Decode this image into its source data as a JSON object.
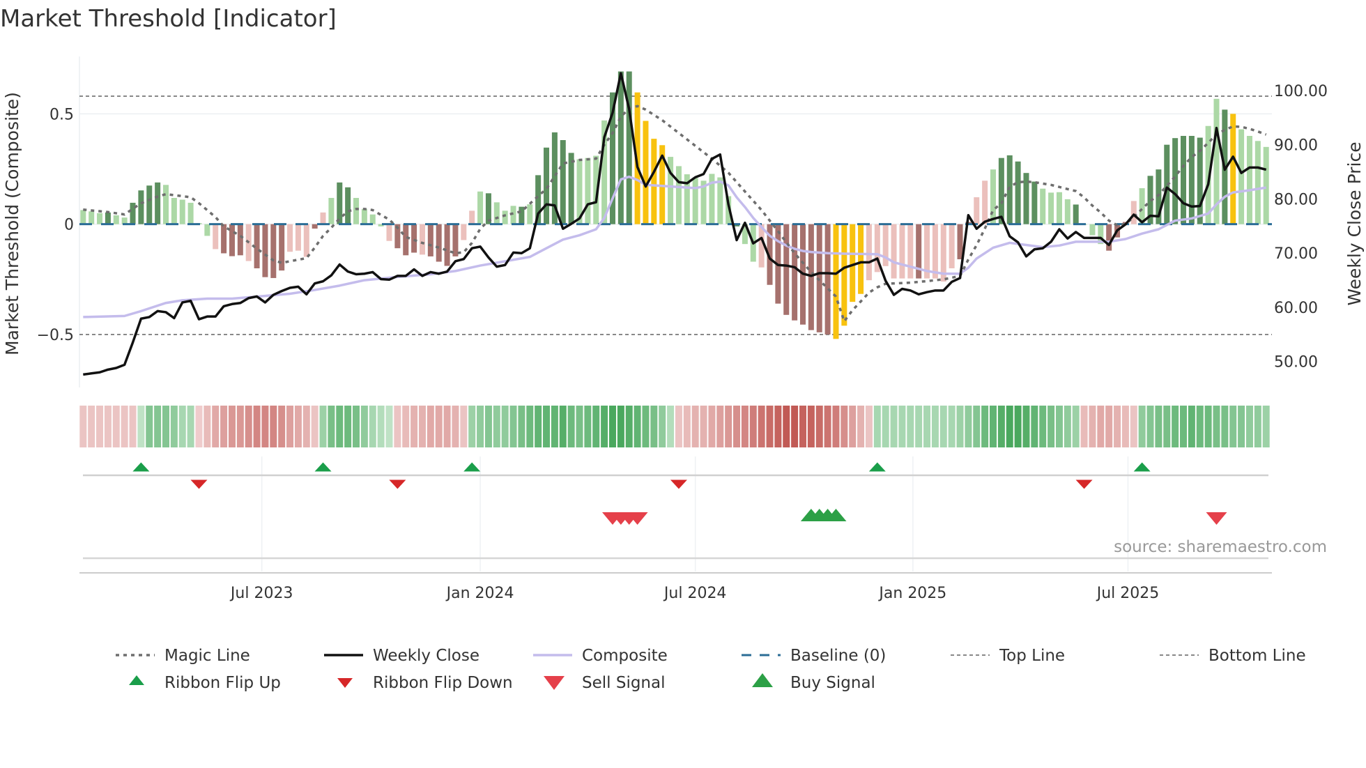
{
  "chart_data": {
    "type": "bar",
    "title": "Market Threshold [Indicator]",
    "ylabel": "Market Threshold (Composite)",
    "y2label": "Weekly Close Price",
    "source": "source: sharemaestro.com",
    "ylim": [
      -0.74,
      0.76
    ],
    "y2lim": [
      45.2,
      106.3
    ],
    "yticks": [
      {
        "v": 0.5,
        "label": "0.5"
      },
      {
        "v": 0,
        "label": "0"
      },
      {
        "v": -0.5,
        "label": "−0.5"
      }
    ],
    "y2ticks": [
      {
        "v": 100,
        "label": "100.00"
      },
      {
        "v": 90,
        "label": "90.00"
      },
      {
        "v": 80,
        "label": "80.00"
      },
      {
        "v": 70,
        "label": "70.00"
      },
      {
        "v": 60,
        "label": "60.00"
      },
      {
        "v": 50,
        "label": "50.00"
      }
    ],
    "x_unit": "week index",
    "xticks": [
      {
        "week": 21.6,
        "label": "Jul 2023"
      },
      {
        "week": 48.0,
        "label": "Jan 2024"
      },
      {
        "week": 74.0,
        "label": "Jul 2024"
      },
      {
        "week": 100.3,
        "label": "Jan 2025"
      },
      {
        "week": 126.3,
        "label": "Jul 2025"
      }
    ],
    "top_line": 0.58,
    "bottom_line": -0.5,
    "baseline": 0,
    "grid": true,
    "bar_colors": {
      "G": "#5c8f5f",
      "g": "#acd8a6",
      "R": "#a6716d",
      "r": "#ebc0bc",
      "Y": "#f8c20f"
    },
    "composite_bars": [
      0.064,
      0.058,
      0.05,
      0.053,
      0.04,
      0.03,
      0.097,
      0.153,
      0.175,
      0.189,
      0.178,
      0.119,
      0.111,
      0.097,
      0.005,
      -0.053,
      -0.113,
      -0.132,
      -0.145,
      -0.141,
      -0.167,
      -0.2,
      -0.24,
      -0.244,
      -0.21,
      -0.125,
      -0.12,
      -0.148,
      -0.02,
      0.053,
      0.119,
      0.189,
      0.167,
      0.119,
      0.069,
      0.044,
      -0.01,
      -0.076,
      -0.109,
      -0.141,
      -0.129,
      -0.138,
      -0.146,
      -0.17,
      -0.189,
      -0.146,
      -0.072,
      0.061,
      0.148,
      0.14,
      0.099,
      0.061,
      0.083,
      0.079,
      0.09,
      0.222,
      0.347,
      0.416,
      0.381,
      0.323,
      0.294,
      0.3,
      0.31,
      0.47,
      0.597,
      0.692,
      0.692,
      0.597,
      0.468,
      0.387,
      0.358,
      0.305,
      0.263,
      0.226,
      0.209,
      0.197,
      0.228,
      0.212,
      0.127,
      -0.01,
      -0.09,
      -0.17,
      -0.196,
      -0.275,
      -0.36,
      -0.411,
      -0.436,
      -0.455,
      -0.48,
      -0.49,
      -0.5,
      -0.52,
      -0.46,
      -0.352,
      -0.316,
      -0.254,
      -0.217,
      -0.19,
      -0.246,
      -0.246,
      -0.246,
      -0.246,
      -0.246,
      -0.246,
      -0.26,
      -0.2,
      -0.159,
      0.01,
      0.122,
      0.197,
      0.248,
      0.3,
      0.312,
      0.284,
      0.232,
      0.193,
      0.161,
      0.143,
      0.145,
      0.113,
      0.089,
      0.0,
      -0.05,
      -0.09,
      -0.12,
      -0.06,
      0.01,
      0.105,
      0.163,
      0.219,
      0.248,
      0.36,
      0.39,
      0.4,
      0.4,
      0.392,
      0.445,
      0.568,
      0.519,
      0.5,
      0.43,
      0.4,
      0.377,
      0.35
    ],
    "composite_bar_states": "gggGggGGGGggggg rRRRrRRRRrrrRrgGGggggrRRRrRRRRrrgGgggGgGGGGGggggGGGYYYYggggggggGggrRRRRRRRRYYYYrrrrrrRrrrrRRrrgGGGGGggggGgggRRRrgGGGGGGGggGYgggggg",
    "weekly_close": [
      47.6,
      47.8,
      48.0,
      48.5,
      48.8,
      49.4,
      53.5,
      57.9,
      58.2,
      59.3,
      59.1,
      58.0,
      60.9,
      61.2,
      57.8,
      58.3,
      58.3,
      60.2,
      60.6,
      60.8,
      61.7,
      62.0,
      60.9,
      62.3,
      63.0,
      63.6,
      63.8,
      62.4,
      64.4,
      64.8,
      65.9,
      67.9,
      66.6,
      66.1,
      66.2,
      66.5,
      65.2,
      65.1,
      65.8,
      65.8,
      67.0,
      65.8,
      66.5,
      66.2,
      66.6,
      68.5,
      68.9,
      70.9,
      71.2,
      69.2,
      67.5,
      67.8,
      70.1,
      70.0,
      70.9,
      77.3,
      79.0,
      78.8,
      74.5,
      75.4,
      76.4,
      79.0,
      79.4,
      91.4,
      95.9,
      103.2,
      96.6,
      85.9,
      82.3,
      85.0,
      88.0,
      84.8,
      83.1,
      82.9,
      84.0,
      84.6,
      87.4,
      88.2,
      79.0,
      72.4,
      75.6,
      71.8,
      72.8,
      69.0,
      67.8,
      67.7,
      67.4,
      66.2,
      65.8,
      66.3,
      66.3,
      66.2,
      67.3,
      67.8,
      68.3,
      68.3,
      69.0,
      64.9,
      62.3,
      63.4,
      63.1,
      62.4,
      62.8,
      63.1,
      63.1,
      64.7,
      65.4,
      77.0,
      74.5,
      75.8,
      76.3,
      76.7,
      73.1,
      72.0,
      69.4,
      70.7,
      70.9,
      72.1,
      74.4,
      72.7,
      73.9,
      72.8,
      72.8,
      72.8,
      71.5,
      74.2,
      75.3,
      77.1,
      75.7,
      76.9,
      76.8,
      82.1,
      80.9,
      79.2,
      78.6,
      78.7,
      82.7,
      93.1,
      85.4,
      87.8,
      84.8,
      85.8,
      85.8,
      85.4
    ],
    "composite_line": [
      [
        0,
        58.2
      ],
      [
        5,
        58.4
      ],
      [
        7,
        59.3
      ],
      [
        10,
        60.8
      ],
      [
        12,
        61.3
      ],
      [
        15,
        61.6
      ],
      [
        18,
        61.6
      ],
      [
        22,
        62.1
      ],
      [
        25,
        62.5
      ],
      [
        28,
        63.2
      ],
      [
        31,
        64.0
      ],
      [
        34,
        65.0
      ],
      [
        38,
        65.6
      ],
      [
        42,
        66.1
      ],
      [
        45,
        66.7
      ],
      [
        48,
        67.7
      ],
      [
        51,
        68.5
      ],
      [
        54,
        69.3
      ],
      [
        56,
        70.9
      ],
      [
        58,
        72.5
      ],
      [
        60,
        73.3
      ],
      [
        62,
        74.4
      ],
      [
        63,
        76.5
      ],
      [
        64,
        80.1
      ],
      [
        65,
        83.6
      ],
      [
        66,
        84.1
      ],
      [
        67,
        83.5
      ],
      [
        68,
        82.6
      ],
      [
        70,
        82.4
      ],
      [
        72,
        82.2
      ],
      [
        74,
        82.0
      ],
      [
        75,
        82.3
      ],
      [
        76,
        83.0
      ],
      [
        77,
        83.2
      ],
      [
        78,
        82.5
      ],
      [
        79,
        80.3
      ],
      [
        80,
        78.5
      ],
      [
        81,
        76.5
      ],
      [
        82,
        74.8
      ],
      [
        83,
        73.2
      ],
      [
        84,
        72.2
      ],
      [
        85,
        71.4
      ],
      [
        86,
        70.8
      ],
      [
        87,
        70.4
      ],
      [
        88,
        70.2
      ],
      [
        90,
        70.0
      ],
      [
        92,
        69.9
      ],
      [
        96,
        69.8
      ],
      [
        97,
        69.2
      ],
      [
        98,
        68.3
      ],
      [
        100,
        67.5
      ],
      [
        102,
        66.7
      ],
      [
        104,
        66.2
      ],
      [
        106,
        66.2
      ],
      [
        107,
        67.3
      ],
      [
        108,
        69.0
      ],
      [
        110,
        71.0
      ],
      [
        112,
        71.9
      ],
      [
        114,
        71.5
      ],
      [
        116,
        71.1
      ],
      [
        118,
        71.4
      ],
      [
        120,
        72.1
      ],
      [
        124,
        72.1
      ],
      [
        126,
        72.6
      ],
      [
        128,
        73.6
      ],
      [
        130,
        74.4
      ],
      [
        132,
        76.0
      ],
      [
        134,
        76.4
      ],
      [
        136,
        77.3
      ],
      [
        137,
        79.0
      ],
      [
        138,
        80.4
      ],
      [
        139,
        81.2
      ],
      [
        141,
        81.6
      ],
      [
        143,
        82.1
      ]
    ],
    "magic_line": [
      [
        0,
        0.066
      ],
      [
        3,
        0.055
      ],
      [
        5,
        0.044
      ],
      [
        7,
        0.095
      ],
      [
        9,
        0.125
      ],
      [
        10,
        0.136
      ],
      [
        12,
        0.127
      ],
      [
        13,
        0.122
      ],
      [
        14,
        0.095
      ],
      [
        16,
        0.032
      ],
      [
        17,
        -0.01
      ],
      [
        19,
        -0.053
      ],
      [
        21,
        -0.111
      ],
      [
        23,
        -0.164
      ],
      [
        24,
        -0.175
      ],
      [
        26,
        -0.161
      ],
      [
        27,
        -0.154
      ],
      [
        28,
        -0.106
      ],
      [
        29,
        -0.053
      ],
      [
        30,
        -0.016
      ],
      [
        31,
        0.026
      ],
      [
        32,
        0.058
      ],
      [
        33,
        0.069
      ],
      [
        34,
        0.069
      ],
      [
        35,
        0.064
      ],
      [
        36,
        0.042
      ],
      [
        37,
        0.021
      ],
      [
        38,
        -0.016
      ],
      [
        39,
        -0.058
      ],
      [
        41,
        -0.085
      ],
      [
        43,
        -0.106
      ],
      [
        45,
        -0.132
      ],
      [
        46,
        -0.127
      ],
      [
        47,
        -0.085
      ],
      [
        48,
        -0.021
      ],
      [
        49,
        0.016
      ],
      [
        51,
        0.04
      ],
      [
        53,
        0.058
      ],
      [
        55,
        0.127
      ],
      [
        56,
        0.16
      ],
      [
        58,
        0.275
      ],
      [
        60,
        0.291
      ],
      [
        62,
        0.297
      ],
      [
        63,
        0.36
      ],
      [
        64,
        0.413
      ],
      [
        65,
        0.487
      ],
      [
        66,
        0.524
      ],
      [
        67,
        0.535
      ],
      [
        68,
        0.519
      ],
      [
        70,
        0.471
      ],
      [
        72,
        0.413
      ],
      [
        74,
        0.355
      ],
      [
        76,
        0.297
      ],
      [
        78,
        0.233
      ],
      [
        80,
        0.148
      ],
      [
        82,
        0.064
      ],
      [
        84,
        -0.032
      ],
      [
        86,
        -0.132
      ],
      [
        88,
        -0.217
      ],
      [
        90,
        -0.291
      ],
      [
        91,
        -0.328
      ],
      [
        92,
        -0.44
      ],
      [
        93,
        -0.39
      ],
      [
        94,
        -0.35
      ],
      [
        95,
        -0.31
      ],
      [
        96,
        -0.286
      ],
      [
        97,
        -0.27
      ],
      [
        100,
        -0.265
      ],
      [
        102,
        -0.258
      ],
      [
        104,
        -0.25
      ],
      [
        106,
        -0.235
      ],
      [
        107,
        -0.16
      ],
      [
        108,
        -0.095
      ],
      [
        109,
        -0.02
      ],
      [
        110,
        0.064
      ],
      [
        111,
        0.095
      ],
      [
        112,
        0.17
      ],
      [
        113,
        0.19
      ],
      [
        114,
        0.193
      ],
      [
        115,
        0.19
      ],
      [
        117,
        0.178
      ],
      [
        119,
        0.159
      ],
      [
        120,
        0.15
      ],
      [
        121,
        0.121
      ],
      [
        122,
        0.084
      ],
      [
        123,
        0.053
      ],
      [
        124,
        0.016
      ],
      [
        125,
        -0.005
      ],
      [
        126,
        0.0
      ],
      [
        127,
        0.032
      ],
      [
        128,
        0.069
      ],
      [
        129,
        0.105
      ],
      [
        130,
        0.132
      ],
      [
        131,
        0.174
      ],
      [
        132,
        0.216
      ],
      [
        133,
        0.264
      ],
      [
        134,
        0.304
      ],
      [
        135,
        0.332
      ],
      [
        136,
        0.369
      ],
      [
        137,
        0.406
      ],
      [
        138,
        0.427
      ],
      [
        139,
        0.443
      ],
      [
        140,
        0.441
      ],
      [
        141,
        0.432
      ],
      [
        142,
        0.42
      ],
      [
        143,
        0.406
      ]
    ],
    "ribbon": [
      -0.15,
      -0.15,
      -0.15,
      -0.15,
      -0.15,
      -0.15,
      -0.15,
      0.1,
      0.35,
      0.35,
      0.35,
      0.3,
      0.2,
      0.2,
      -0.1,
      -0.2,
      -0.3,
      -0.35,
      -0.4,
      -0.4,
      -0.45,
      -0.5,
      -0.5,
      -0.5,
      -0.45,
      -0.35,
      -0.3,
      -0.25,
      -0.15,
      0.25,
      0.4,
      0.45,
      0.45,
      0.4,
      0.3,
      0.2,
      0.15,
      0.1,
      -0.15,
      -0.2,
      -0.25,
      -0.25,
      -0.3,
      -0.3,
      -0.3,
      -0.25,
      -0.15,
      0.25,
      0.3,
      0.35,
      0.3,
      0.3,
      0.35,
      0.4,
      0.45,
      0.5,
      0.5,
      0.5,
      0.55,
      0.45,
      0.4,
      0.45,
      0.5,
      0.55,
      0.6,
      0.6,
      0.55,
      0.5,
      0.45,
      0.4,
      0.3,
      0.15,
      -0.15,
      -0.2,
      -0.25,
      -0.25,
      -0.3,
      -0.35,
      -0.4,
      -0.45,
      -0.5,
      -0.55,
      -0.6,
      -0.65,
      -0.7,
      -0.75,
      -0.75,
      -0.7,
      -0.7,
      -0.65,
      -0.6,
      -0.55,
      -0.45,
      -0.35,
      -0.25,
      -0.15,
      0.2,
      0.2,
      0.2,
      0.2,
      0.2,
      0.2,
      0.2,
      0.2,
      0.2,
      0.2,
      0.25,
      0.3,
      0.35,
      0.45,
      0.5,
      0.55,
      0.6,
      0.6,
      0.55,
      0.5,
      0.45,
      0.4,
      0.35,
      0.3,
      0.25,
      -0.2,
      -0.25,
      -0.3,
      -0.3,
      -0.25,
      -0.2,
      -0.15,
      0.3,
      0.35,
      0.4,
      0.4,
      0.45,
      0.45,
      0.5,
      0.45,
      0.45,
      0.4,
      0.4,
      0.35,
      0.35,
      0.3,
      0.3,
      0.25
    ],
    "ribbon_flip_up": [
      7,
      29,
      47,
      96,
      128
    ],
    "ribbon_flip_down": [
      14,
      38,
      72,
      121
    ],
    "sell_signals": [
      64,
      65,
      66,
      67,
      137
    ],
    "buy_signals": [
      88,
      89,
      90,
      91
    ],
    "colors": {
      "weekly_close": "#111111",
      "composite": "#c4bcec",
      "magic": "#6e6e6e",
      "baseline": "#2b6d96",
      "top_bottom": "#888888",
      "flip_up": "#1a9e4a",
      "flip_down": "#d62728",
      "sell": "#e5404a",
      "buy": "#2ca046"
    },
    "legend": [
      {
        "label": "Magic Line",
        "kind": "magic"
      },
      {
        "label": "Weekly Close",
        "kind": "close"
      },
      {
        "label": "Composite",
        "kind": "composite"
      },
      {
        "label": "Baseline (0)",
        "kind": "baseline"
      },
      {
        "label": "Top Line",
        "kind": "topline"
      },
      {
        "label": "Bottom Line",
        "kind": "bottomline"
      },
      {
        "label": "Ribbon Flip Up",
        "kind": "flipup"
      },
      {
        "label": "Ribbon Flip Down",
        "kind": "flipdown"
      },
      {
        "label": "Sell Signal",
        "kind": "sell"
      },
      {
        "label": "Buy Signal",
        "kind": "buy"
      }
    ]
  }
}
